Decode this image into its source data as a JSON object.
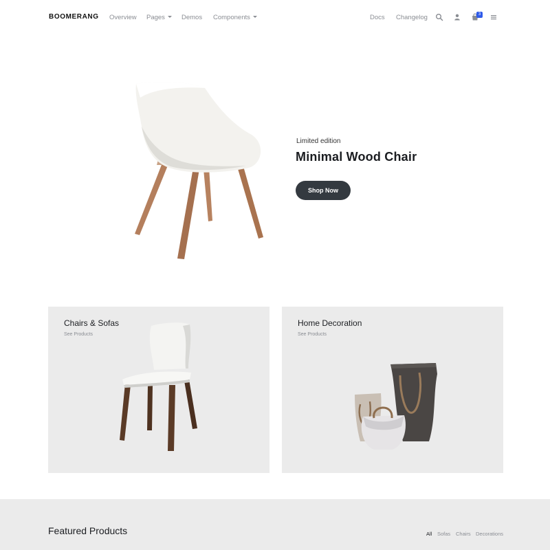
{
  "brand": "BOOMERANG",
  "nav": {
    "links": [
      {
        "label": "Overview",
        "dropdown": false
      },
      {
        "label": "Pages",
        "dropdown": true
      },
      {
        "label": "Demos",
        "dropdown": false
      },
      {
        "label": "Components",
        "dropdown": true
      }
    ],
    "right_links": [
      "Docs",
      "Changelog"
    ],
    "icons": [
      "search-icon",
      "user-icon",
      "cart-icon",
      "menu-icon"
    ],
    "cart_count": "3",
    "colors": {
      "link": "#8a8d93",
      "badge": "#2f5bea"
    }
  },
  "hero": {
    "eyebrow": "Limited edition",
    "title": "Minimal Wood Chair",
    "button": "Shop Now",
    "button_color": "#343a40"
  },
  "categories": [
    {
      "title": "Chairs & Sofas",
      "link": "See Products",
      "image": "white-chair-image"
    },
    {
      "title": "Home Decoration",
      "link": "See Products",
      "image": "decor-bags-image"
    }
  ],
  "featured": {
    "title": "Featured Products",
    "filters": [
      "All",
      "Sofas",
      "Chairs",
      "Decorations"
    ],
    "active_filter": "All"
  },
  "colors": {
    "card_bg": "#ebebeb",
    "text": "#1b1d21"
  }
}
